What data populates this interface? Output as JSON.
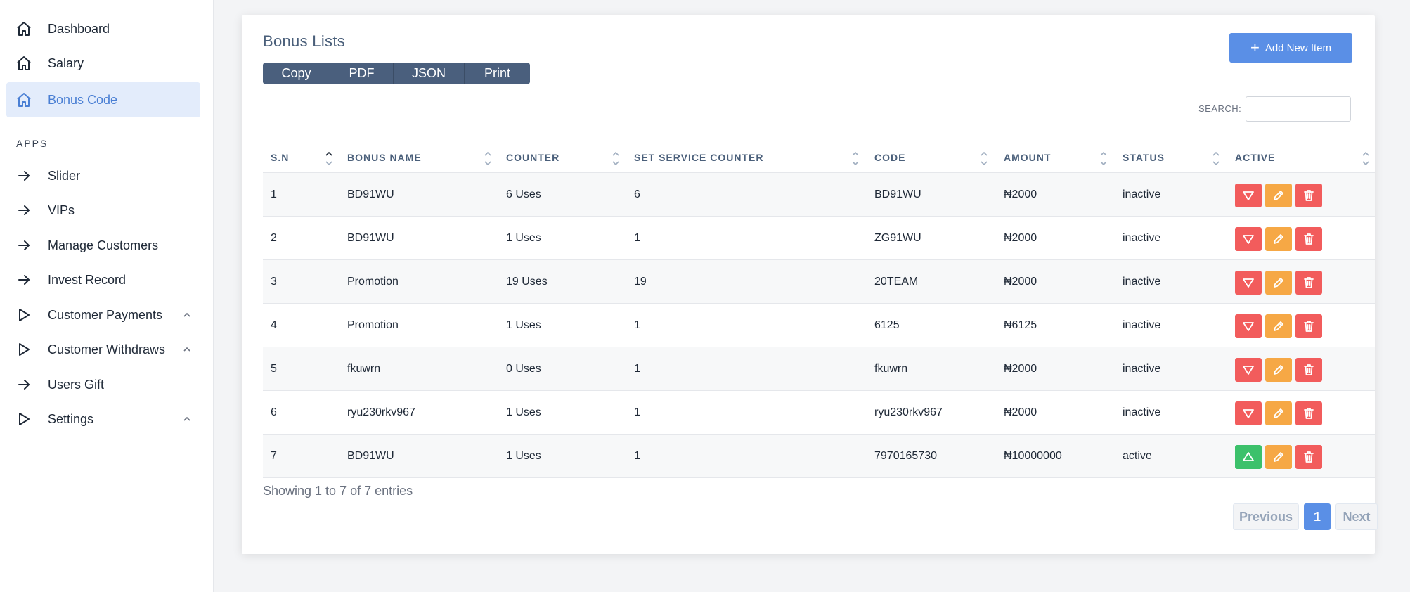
{
  "sidebar": {
    "items": [
      {
        "label": "Dashboard",
        "icon": "home-icon"
      },
      {
        "label": "Salary",
        "icon": "home-icon"
      },
      {
        "label": "Bonus Code",
        "icon": "home-icon",
        "active": true
      }
    ],
    "section_label": "APPS",
    "apps": [
      {
        "label": "Slider",
        "icon": "arrow-right-icon"
      },
      {
        "label": "VIPs",
        "icon": "arrow-right-icon"
      },
      {
        "label": "Manage Customers",
        "icon": "arrow-right-icon"
      },
      {
        "label": "Invest Record",
        "icon": "arrow-right-icon"
      },
      {
        "label": "Customer Payments",
        "icon": "play-icon",
        "expandable": true
      },
      {
        "label": "Customer Withdraws",
        "icon": "play-icon",
        "expandable": true
      },
      {
        "label": "Users Gift",
        "icon": "arrow-right-icon"
      },
      {
        "label": "Settings",
        "icon": "play-icon",
        "expandable": true
      }
    ]
  },
  "main": {
    "title": "Bonus Lists",
    "export_buttons": [
      "Copy",
      "PDF",
      "JSON",
      "Print"
    ],
    "add_button": "Add New Item",
    "search_label": "SEARCH:",
    "search_value": "",
    "table": {
      "columns": [
        "S.N",
        "BONUS NAME",
        "COUNTER",
        "SET SERVICE COUNTER",
        "CODE",
        "AMOUNT",
        "STATUS",
        "ACTIVE"
      ],
      "rows": [
        {
          "sn": "1",
          "name": "BD91WU",
          "counter": "6 Uses",
          "set_counter": "6",
          "code": "BD91WU",
          "amount": "₦2000",
          "status": "inactive"
        },
        {
          "sn": "2",
          "name": "BD91WU",
          "counter": "1 Uses",
          "set_counter": "1",
          "code": "ZG91WU",
          "amount": "₦2000",
          "status": "inactive"
        },
        {
          "sn": "3",
          "name": "Promotion",
          "counter": "19 Uses",
          "set_counter": "19",
          "code": "20TEAM",
          "amount": "₦2000",
          "status": "inactive"
        },
        {
          "sn": "4",
          "name": "Promotion",
          "counter": "1 Uses",
          "set_counter": "1",
          "code": "6125",
          "amount": "₦6125",
          "status": "inactive"
        },
        {
          "sn": "5",
          "name": "fkuwrn",
          "counter": "0 Uses",
          "set_counter": "1",
          "code": "fkuwrn",
          "amount": "₦2000",
          "status": "inactive"
        },
        {
          "sn": "6",
          "name": "ryu230rkv967",
          "counter": "1 Uses",
          "set_counter": "1",
          "code": "ryu230rkv967",
          "amount": "₦2000",
          "status": "inactive"
        },
        {
          "sn": "7",
          "name": "BD91WU",
          "counter": "1 Uses",
          "set_counter": "1",
          "code": "7970165730",
          "amount": "₦10000000",
          "status": "active"
        }
      ]
    },
    "showing_text": "Showing 1 to 7 of 7 entries",
    "pagination": {
      "previous": "Previous",
      "current": "1",
      "next": "Next"
    }
  },
  "colors": {
    "accent": "#5a8fe6",
    "danger": "#f25c5c",
    "warning": "#f6a845",
    "success": "#3cc16b",
    "export_bg": "#4a5f7d"
  }
}
